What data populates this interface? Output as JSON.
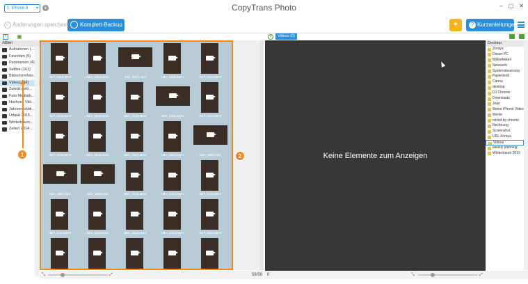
{
  "window": {
    "device": "1: iPhone 6",
    "app_title": "CopyTrans Photo",
    "controls": [
      "–",
      "▢",
      "✕"
    ]
  },
  "toolbar": {
    "save_label": "Änderungen speichern",
    "backup_label": "Komplett-Backup",
    "guide_label": "Kurzanleitungen",
    "colors": {
      "accent": "#2a8fd8",
      "highlight": "#f0891f",
      "bulb": "#f5b41c"
    }
  },
  "albums": {
    "header": "Alben",
    "items": [
      {
        "label": "Aufnahmen (...",
        "icon": "camera-icon"
      },
      {
        "label": "Favoriten (5)",
        "icon": "heart-icon"
      },
      {
        "label": "Panoramen (4)",
        "icon": "panorama-icon"
      },
      {
        "label": "Selfies (161)",
        "icon": "selfie-icon"
      },
      {
        "label": "Bildschirmfoto...",
        "icon": "screenshot-icon"
      },
      {
        "label": "Videos (34)",
        "icon": "video-icon",
        "selected": true
      },
      {
        "label": "Zuletzt gelö...",
        "icon": "trash-icon"
      },
      {
        "label": "Foto Mediath...",
        "icon": "album-icon"
      },
      {
        "label": "Hochzeit Vikt...",
        "icon": "album-icon"
      },
      {
        "label": "Jahresrückbli...",
        "icon": "album-icon"
      },
      {
        "label": "Urlaub 2015...",
        "icon": "album-icon"
      },
      {
        "label": "Wintertraum...",
        "icon": "album-icon"
      },
      {
        "label": "Zeiten 2014 ...",
        "icon": "album-icon"
      }
    ]
  },
  "grid": {
    "thumbs": [
      {
        "label": "IMG_0318.MOV",
        "shape": "p"
      },
      {
        "label": "IMG_0314.MOV",
        "shape": "p"
      },
      {
        "label": "IMG_0327.mp4",
        "shape": "l"
      },
      {
        "label": "IMG_5422.MOV",
        "shape": "p"
      },
      {
        "label": "IMG_0301.MOV",
        "shape": "p"
      },
      {
        "label": "IMG_0338.MOV",
        "shape": "p"
      },
      {
        "label": "IMG_0339.MOV",
        "shape": "p"
      },
      {
        "label": "IMG_0340.MOV",
        "shape": "p"
      },
      {
        "label": "IMG_5442.MOV",
        "shape": "l"
      },
      {
        "label": "IMG_0342.MOV",
        "shape": "p"
      },
      {
        "label": "IMG_0308.MOV",
        "shape": "p"
      },
      {
        "label": "IMG_0309.MOV",
        "shape": "p"
      },
      {
        "label": "IMG_0297.MOV",
        "shape": "p"
      },
      {
        "label": "IMG_0313.MOV",
        "shape": "p"
      },
      {
        "label": "IMG_0885.mp4",
        "shape": "l"
      },
      {
        "label": "IMG_5867.mp4",
        "shape": "l"
      },
      {
        "label": "IMG_5866.mp4",
        "shape": "l"
      },
      {
        "label": "IMG_0120.MOV",
        "shape": "p"
      },
      {
        "label": "IMG_0114.MOV",
        "shape": "p"
      },
      {
        "label": "IMG_0115.MOV",
        "shape": "p"
      },
      {
        "label": "IMG_0110.MOV",
        "shape": "p"
      },
      {
        "label": "IMG_0112.MOV",
        "shape": "p"
      },
      {
        "label": "IMG_0113.MOV",
        "shape": "p"
      },
      {
        "label": "IMG_0114.MOV",
        "shape": "p"
      },
      {
        "label": "IMG_0101.MOV",
        "shape": "p"
      },
      {
        "label": "",
        "shape": "p"
      },
      {
        "label": "",
        "shape": "p"
      },
      {
        "label": "",
        "shape": "p"
      },
      {
        "label": "",
        "shape": "p"
      },
      {
        "label": "",
        "shape": "p"
      }
    ],
    "count": "56/56",
    "badge_1": "1",
    "badge_2": "2"
  },
  "right": {
    "tab": "Videos (0)",
    "empty_message": "Keine Elemente zum Anzeigen",
    "count": "0"
  },
  "tree": {
    "header": "Desktop",
    "items": [
      {
        "label": "Zoraya"
      },
      {
        "label": "Dieser PC"
      },
      {
        "label": "Bibliotheken"
      },
      {
        "label": "Netzwerk"
      },
      {
        "label": "Systemsteuerung"
      },
      {
        "label": "Papierkorb"
      },
      {
        "label": "Canna"
      },
      {
        "label": "desktop"
      },
      {
        "label": "DJ Chrome"
      },
      {
        "label": "Downloads"
      },
      {
        "label": "Jean"
      },
      {
        "label": "Meine iPhone Videos"
      },
      {
        "label": "Merke"
      },
      {
        "label": "mixed by chrome"
      },
      {
        "label": "Rechnung"
      },
      {
        "label": "Screenshot"
      },
      {
        "label": "URL Zoraya"
      },
      {
        "label": "Videos",
        "selected": true
      },
      {
        "label": "weekly planning"
      },
      {
        "label": "Wintertraum 2015"
      }
    ]
  }
}
